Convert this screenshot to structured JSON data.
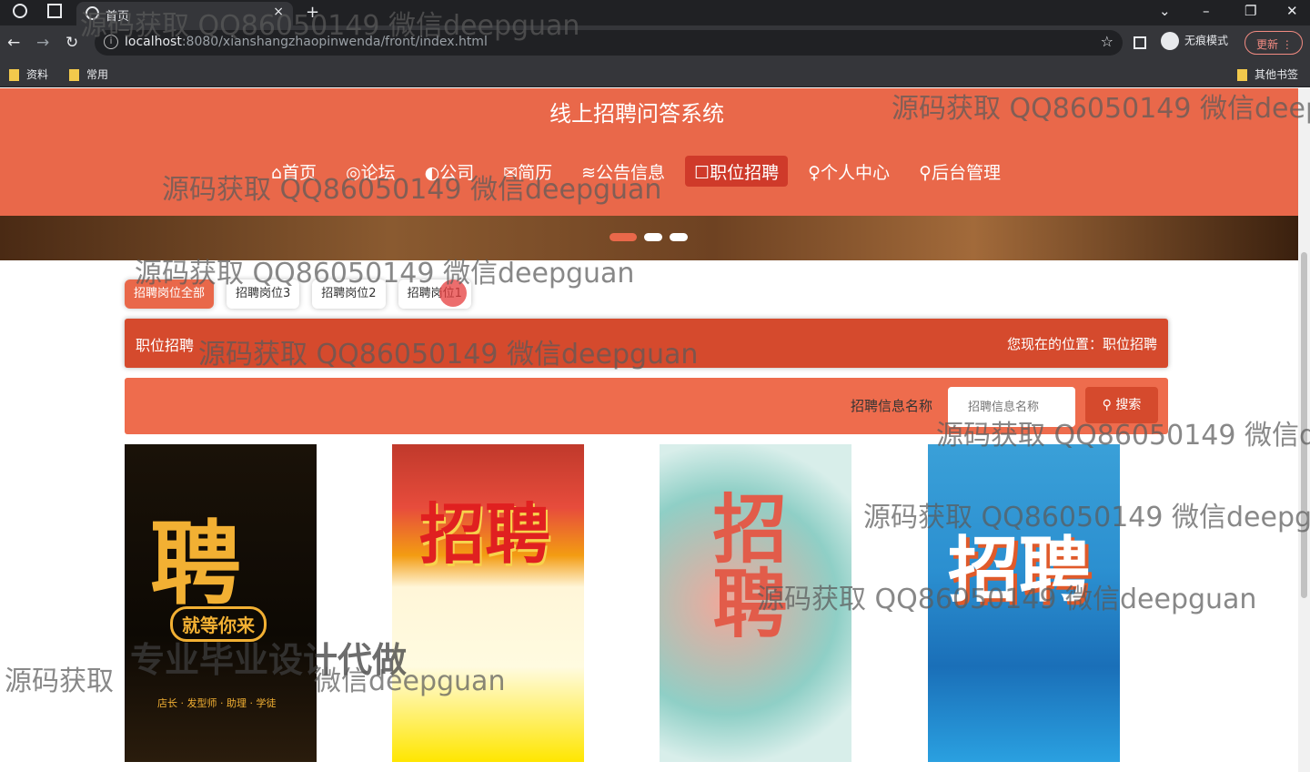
{
  "browser": {
    "tab_title": "首页",
    "tab_close": "×",
    "new_tab": "+",
    "url_host": "localhost",
    "url_rest": ":8080/xianshangzhaopinwenda/front/index.html",
    "incognito_label": "无痕模式",
    "update_label": "更新",
    "bookmarks": [
      "资料",
      "常用"
    ],
    "other_bookmarks": "其他书签"
  },
  "site": {
    "title": "线上招聘问答系统",
    "menu": [
      {
        "label": "⌂首页"
      },
      {
        "label": "◎论坛"
      },
      {
        "label": "◐公司"
      },
      {
        "label": "✉简历"
      },
      {
        "label": "≋公告信息"
      },
      {
        "label": "☐职位招聘"
      },
      {
        "label": "♀个人中心"
      },
      {
        "label": "⚲后台管理"
      }
    ],
    "active_menu": "☐职位招聘"
  },
  "categories": [
    {
      "label": "招聘岗位全部",
      "active": true
    },
    {
      "label": "招聘岗位3",
      "active": false
    },
    {
      "label": "招聘岗位2",
      "active": false
    },
    {
      "label": "招聘岗位1",
      "active": false
    }
  ],
  "breadcrumb": {
    "left": "职位招聘",
    "right": "您现在的位置：职位招聘"
  },
  "search": {
    "label": "招聘信息名称",
    "placeholder": "招聘信息名称",
    "button": "⚲ 搜索"
  },
  "posters": [
    {
      "text": "聘",
      "sub": "就等你来",
      "extra": "店长 · 发型师 · 助理 · 学徒"
    },
    {
      "text": "招聘"
    },
    {
      "text": "招聘"
    },
    {
      "text": "招聘"
    }
  ],
  "watermarks": [
    "源码获取 QQ86050149 微信deepguan",
    "源码获取 QQ86050149 微信deepguan",
    "源码获取 QQ86050149 微信deepguan",
    "源码获取 QQ86050149 微信deepguan",
    "源码获取 QQ86050149 微信d",
    "源码获取 QQ86050149 微信deepgu",
    "源码获取 QQ86050149 微信deepguan",
    "源码获取 QQ86050149 微信deep",
    "源码获取",
    "专业毕业设计代做",
    "微信deepguan"
  ]
}
